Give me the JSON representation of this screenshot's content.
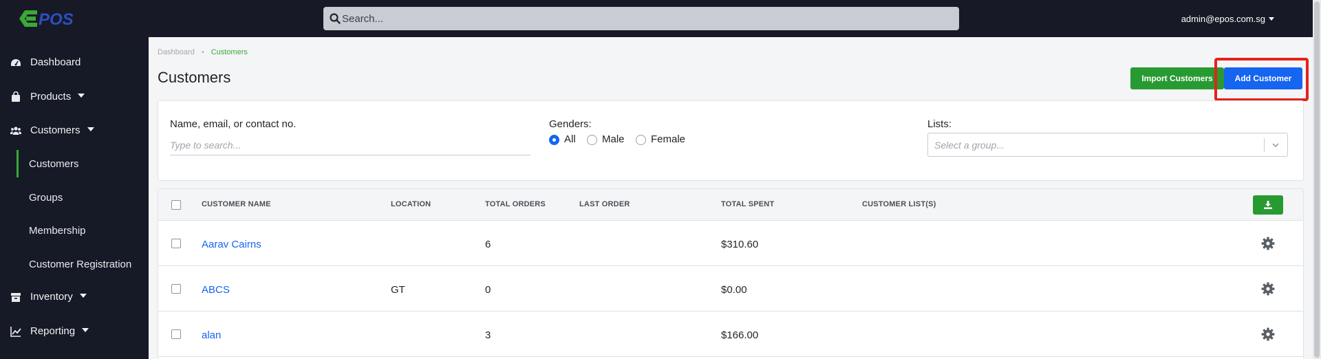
{
  "header": {
    "logo_text": "EPOS",
    "search_placeholder": "Search...",
    "user_email": "admin@epos.com.sg"
  },
  "sidebar": {
    "items": [
      {
        "label": "Dashboard",
        "icon": "dashboard-icon"
      },
      {
        "label": "Products",
        "icon": "shopping-bag-icon"
      },
      {
        "label": "Customers",
        "icon": "users-icon"
      },
      {
        "label": "Inventory",
        "icon": "archive-icon"
      },
      {
        "label": "Reporting",
        "icon": "chart-line-icon"
      }
    ],
    "sub_items": [
      {
        "label": "Customers",
        "active": true
      },
      {
        "label": "Groups"
      },
      {
        "label": "Membership"
      },
      {
        "label": "Customer Registration"
      }
    ]
  },
  "breadcrumb": {
    "home": "Dashboard",
    "current": "Customers"
  },
  "page": {
    "title": "Customers"
  },
  "actions": {
    "import_label": "Import Customers",
    "add_label": "Add Customer"
  },
  "filters": {
    "name_label": "Name, email, or contact no.",
    "name_placeholder": "Type to search...",
    "gender_label": "Genders:",
    "gender_options": [
      "All",
      "Male",
      "Female"
    ],
    "gender_selected": "All",
    "lists_label": "Lists:",
    "lists_placeholder": "Select a group..."
  },
  "table": {
    "headers": [
      "CUSTOMER NAME",
      "LOCATION",
      "TOTAL ORDERS",
      "LAST ORDER",
      "TOTAL SPENT",
      "CUSTOMER LIST(S)"
    ],
    "rows": [
      {
        "name": "Aarav Cairns",
        "location": "",
        "total_orders": "6",
        "last_order": "",
        "total_spent": "$310.60",
        "lists": ""
      },
      {
        "name": "ABCS",
        "location": "GT",
        "total_orders": "0",
        "last_order": "",
        "total_spent": "$0.00",
        "lists": ""
      },
      {
        "name": "alan",
        "location": "",
        "total_orders": "3",
        "last_order": "",
        "total_spent": "$166.00",
        "lists": ""
      }
    ]
  },
  "colors": {
    "accent_green": "#3aa935",
    "primary_blue": "#1565f1",
    "sidebar_bg": "#161a26",
    "highlight_red": "#e3231b"
  }
}
